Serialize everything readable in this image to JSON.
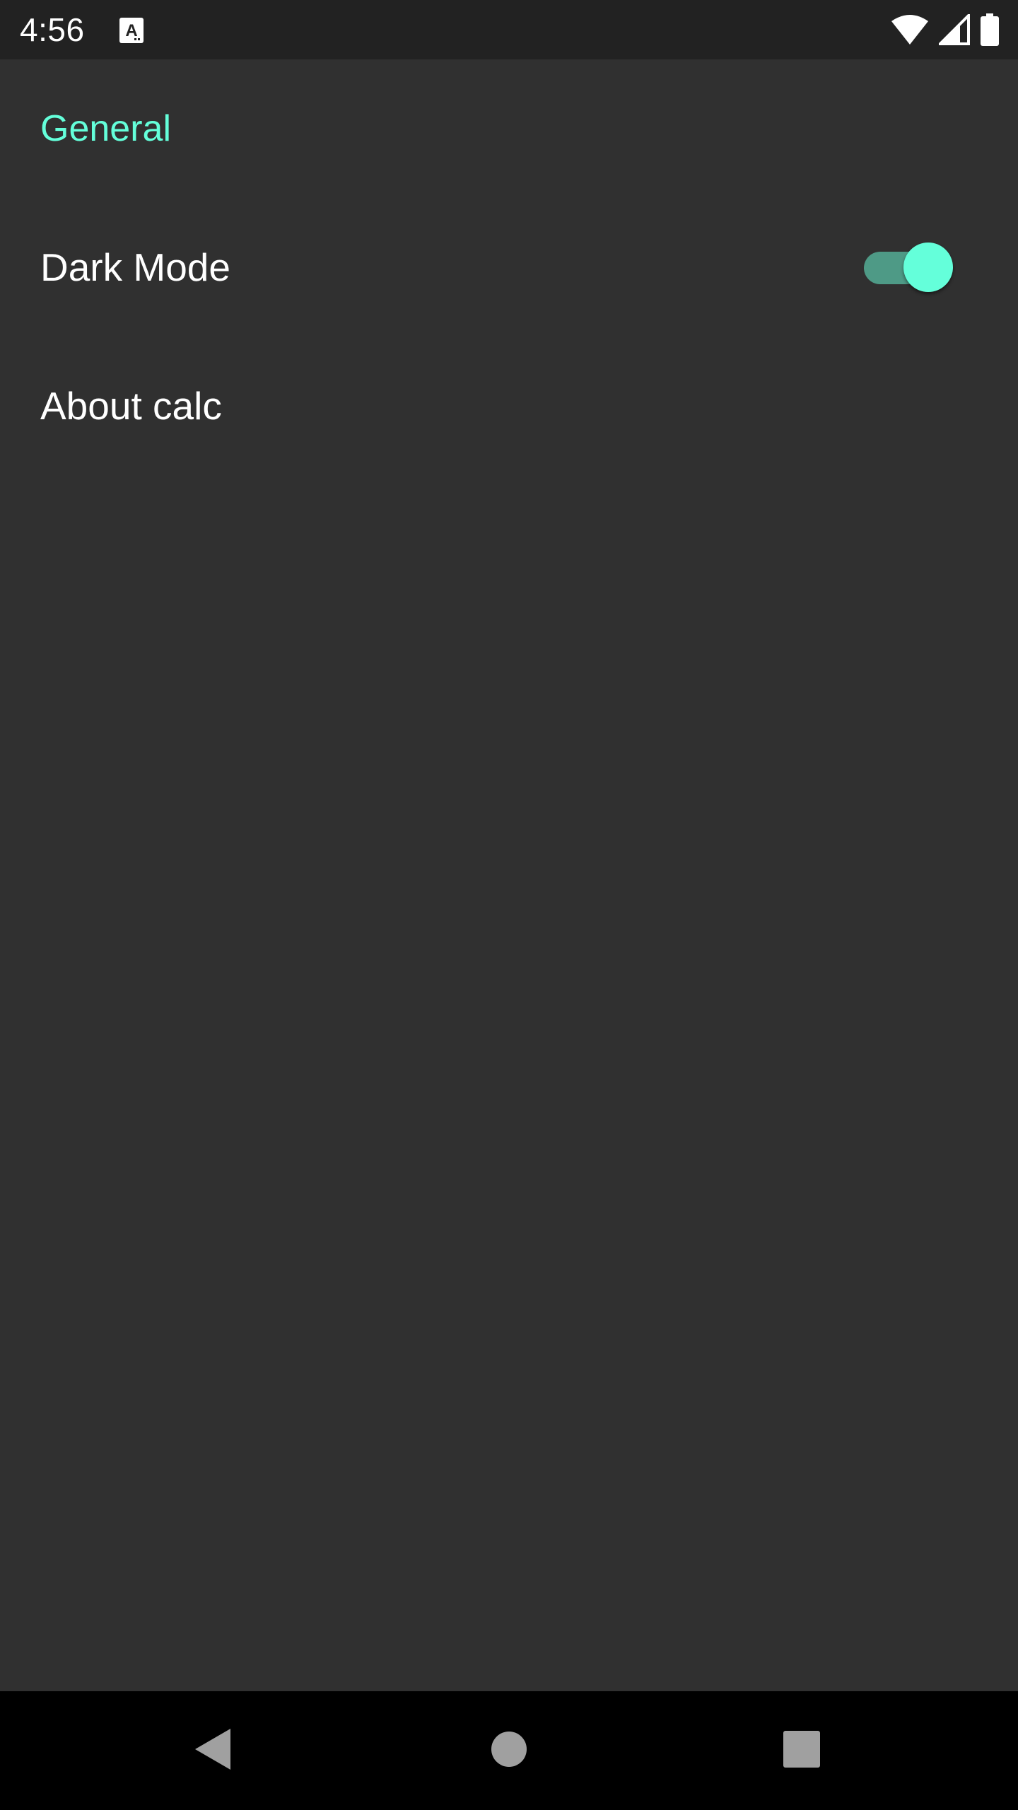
{
  "status_bar": {
    "time": "4:56",
    "notification_icon": "text-a-icon",
    "icons": [
      "wifi-icon",
      "signal-icon",
      "battery-icon"
    ]
  },
  "settings": {
    "section_title": "General",
    "items": [
      {
        "title": "Dark Mode",
        "type": "switch",
        "checked": true
      },
      {
        "title": "About calc",
        "type": "link"
      }
    ]
  },
  "nav_bar": {
    "buttons": [
      "back-icon",
      "home-icon",
      "recents-icon"
    ]
  },
  "colors": {
    "background": "#303030",
    "status_bar": "#222222",
    "accent": "#64ffda",
    "switch_track": "#4e9a86",
    "nav_bar": "#000000",
    "text_primary": "#ffffff"
  }
}
